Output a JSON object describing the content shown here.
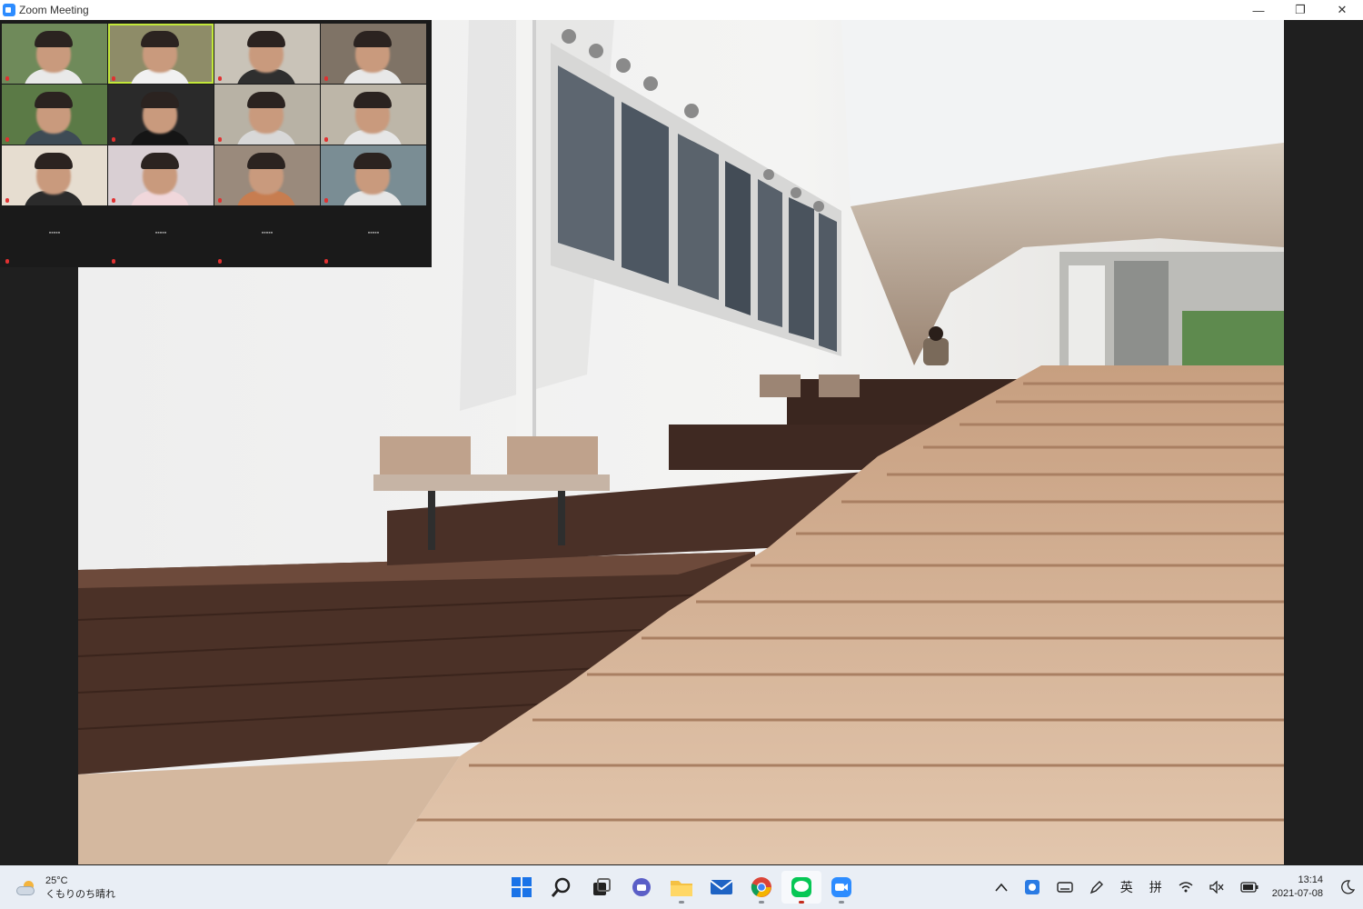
{
  "window": {
    "title": "Zoom Meeting",
    "controls": {
      "minimize": "—",
      "restore": "❐",
      "close": "✕"
    }
  },
  "gallery": {
    "active_speaker_index": 1,
    "participants": [
      {
        "kind": "video",
        "shirt": "#e9e9e9",
        "bg": "#6f8a5a"
      },
      {
        "kind": "video",
        "shirt": "#f1f1f1",
        "bg": "#8e8c68"
      },
      {
        "kind": "video",
        "shirt": "#2f2f2f",
        "bg": "#c9c3b8"
      },
      {
        "kind": "video",
        "shirt": "#e8e8e8",
        "bg": "#7f7366"
      },
      {
        "kind": "video",
        "shirt": "#3e4b55",
        "bg": "#5b7a46"
      },
      {
        "kind": "video",
        "shirt": "#151515",
        "bg": "#2a2a2a"
      },
      {
        "kind": "video",
        "shirt": "#d8d8d8",
        "bg": "#b8b2a5"
      },
      {
        "kind": "video",
        "shirt": "#e6e6e6",
        "bg": "#bdb6a8"
      },
      {
        "kind": "video",
        "shirt": "#2b2b2b",
        "bg": "#e6ddd0"
      },
      {
        "kind": "video",
        "shirt": "#f0d7db",
        "bg": "#d9cfd3"
      },
      {
        "kind": "video",
        "shirt": "#c77d50",
        "bg": "#9a8a7c"
      },
      {
        "kind": "video",
        "shirt": "#e6e6e6",
        "bg": "#7a8d94"
      },
      {
        "kind": "name",
        "name": "▪▪▪▪▪"
      },
      {
        "kind": "name",
        "name": "▪▪▪▪▪"
      },
      {
        "kind": "name",
        "name": "▪▪▪▪▪"
      },
      {
        "kind": "name",
        "name": "▪▪▪▪▪"
      }
    ]
  },
  "taskbar": {
    "weather": {
      "temperature": "25°C",
      "condition": "くもりのち晴れ",
      "icon": "partly-cloudy-icon"
    },
    "apps": [
      {
        "name": "start",
        "icon": "windows-icon"
      },
      {
        "name": "search",
        "icon": "search-icon"
      },
      {
        "name": "task-view",
        "icon": "task-view-icon"
      },
      {
        "name": "teams-chat",
        "icon": "chat-icon"
      },
      {
        "name": "file-explorer",
        "icon": "folder-icon",
        "running": true
      },
      {
        "name": "mail",
        "icon": "mail-icon"
      },
      {
        "name": "chrome",
        "icon": "chrome-icon",
        "running": true
      },
      {
        "name": "line",
        "icon": "line-icon",
        "running": true,
        "active": true
      },
      {
        "name": "zoom",
        "icon": "zoom-icon",
        "running": true
      }
    ],
    "tray": {
      "chevron": "^",
      "ime_mode": "英",
      "ime_name": "拼",
      "time": "13:14",
      "date": "2021-07-08"
    }
  },
  "colors": {
    "zoom_blue": "#2d8cff",
    "active_speaker_border": "#c3e83a",
    "taskbar_bg": "#e9eef5",
    "meeting_bg": "#1f1f1f",
    "muted_red": "#e03131"
  }
}
